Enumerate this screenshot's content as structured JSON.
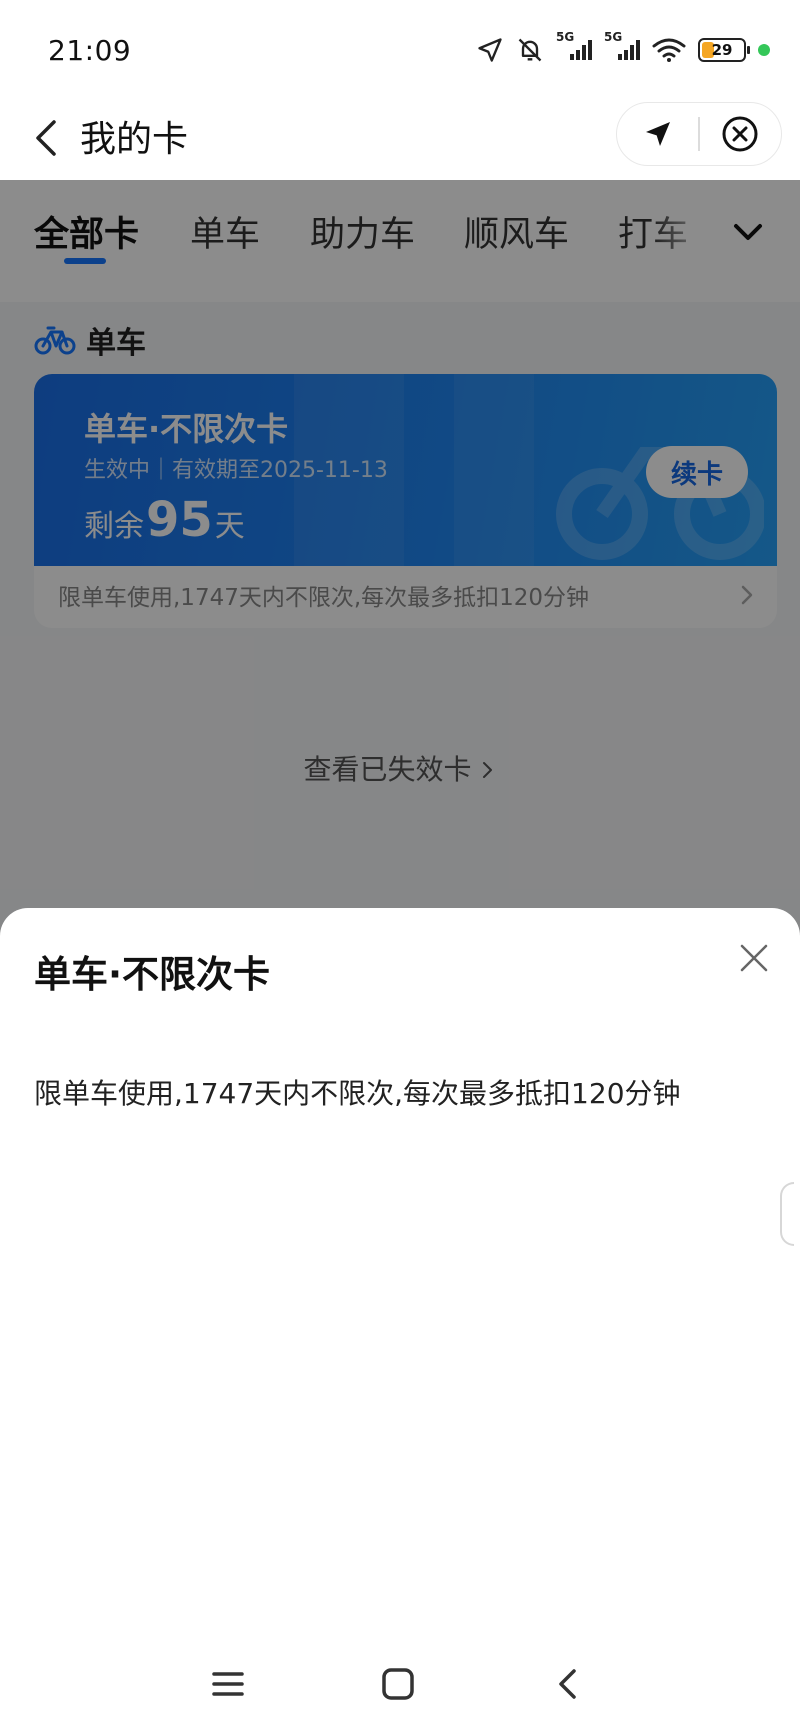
{
  "status_bar": {
    "time": "21:09",
    "signal_1_label": "5G",
    "signal_2_label": "5G",
    "battery_level": "29",
    "icons": [
      "location-arrow-icon",
      "bell-off-icon",
      "signal-5g-icon",
      "signal-5g-icon",
      "wifi-icon",
      "battery-icon"
    ]
  },
  "header": {
    "title": "我的卡",
    "icons": [
      "back-arrow-icon",
      "navigation-icon",
      "close-circle-icon"
    ]
  },
  "tabs": {
    "items": [
      {
        "label": "全部卡",
        "active": true
      },
      {
        "label": "单车",
        "active": false
      },
      {
        "label": "助力车",
        "active": false
      },
      {
        "label": "顺风车",
        "active": false
      },
      {
        "label": "打车",
        "active": false
      }
    ],
    "accent_color": "#1677ff"
  },
  "section": {
    "title": "单车",
    "icon": "bicycle-icon"
  },
  "card": {
    "name": "单车·不限次卡",
    "status": "生效中｜有效期至2025-11-13",
    "remain_prefix": "剩余",
    "remain_days": "95",
    "remain_suffix": "天",
    "renew_label": "续卡",
    "description": "限单车使用,1747天内不限次,每次最多抵扣120分钟",
    "colors": {
      "start": "#1a6fe8",
      "end": "#27a0f7"
    }
  },
  "invalid_link": "查看已失效卡",
  "sheet": {
    "title": "单车·不限次卡",
    "description": "限单车使用,1747天内不限次,每次最多抵扣120分钟"
  },
  "system_nav": {
    "icons": [
      "menu-icon",
      "home-icon",
      "back-icon"
    ]
  }
}
